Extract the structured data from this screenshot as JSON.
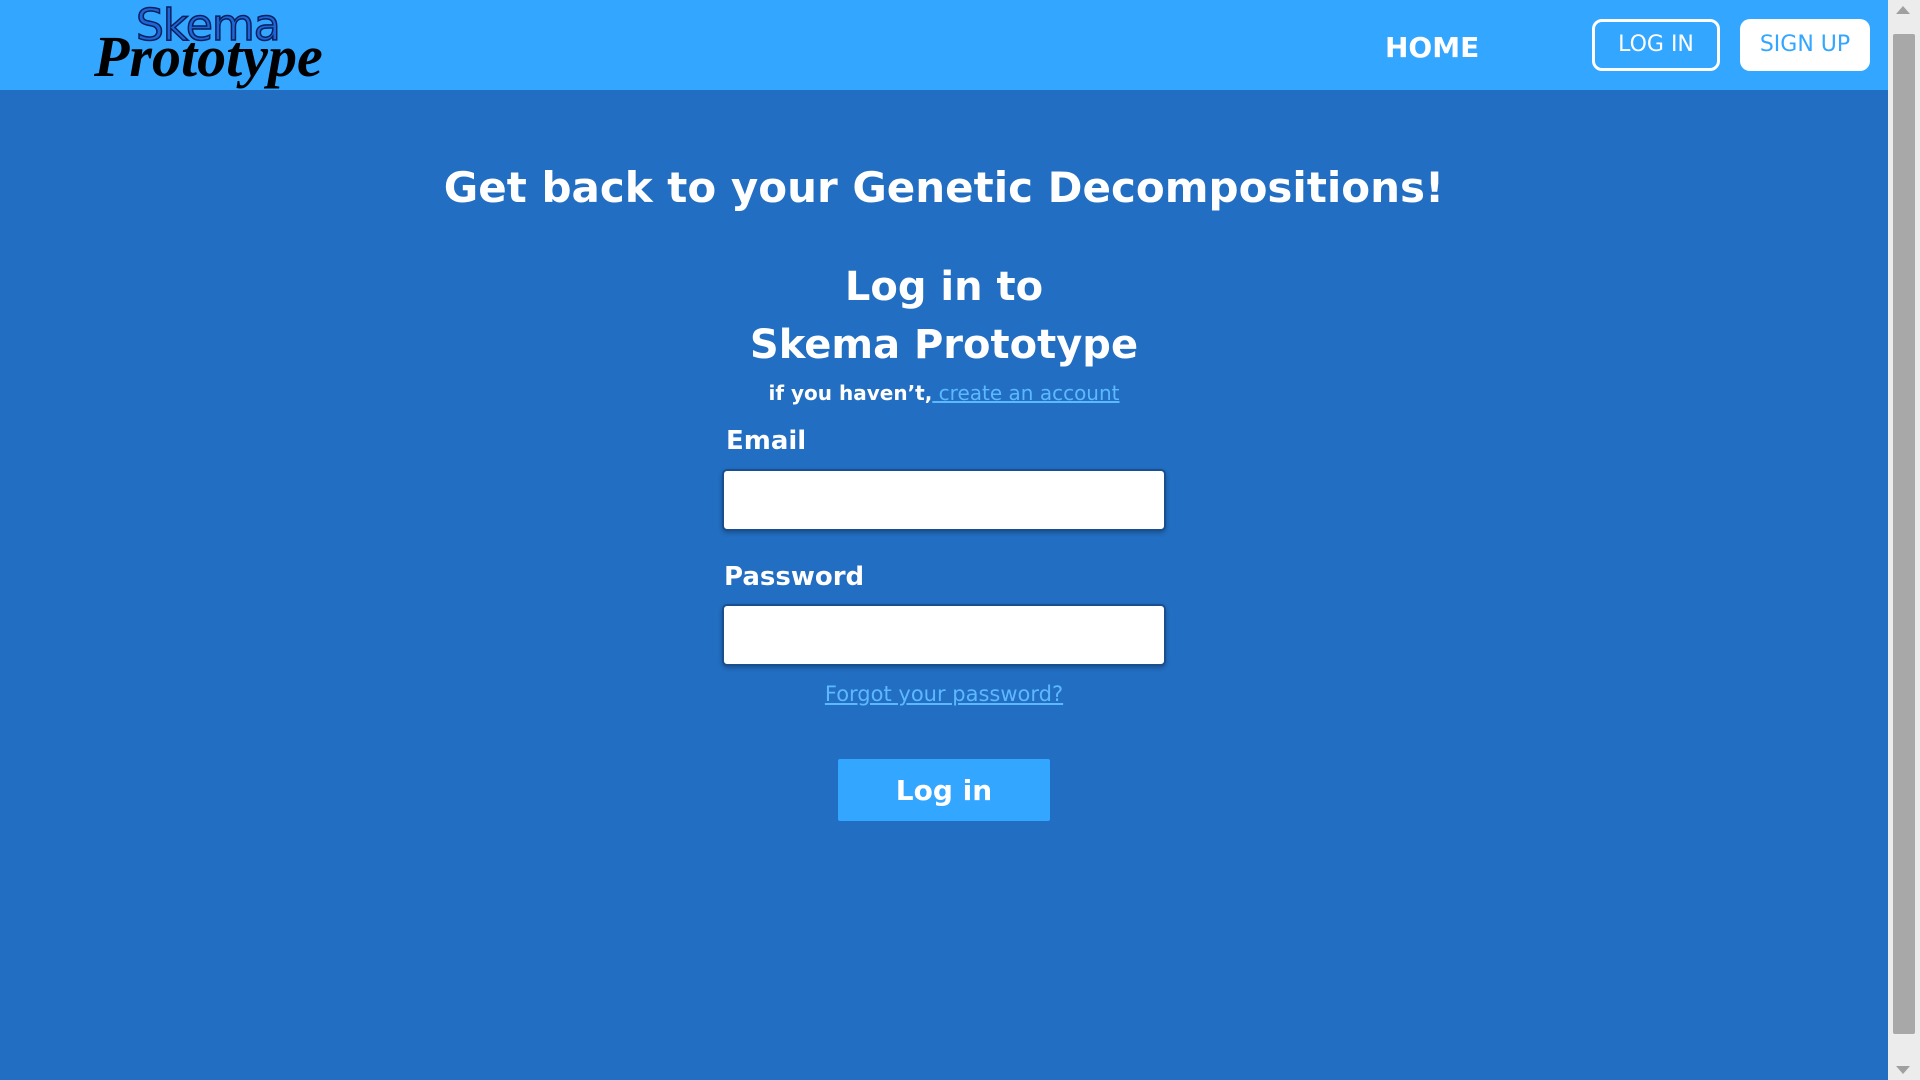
{
  "header": {
    "logo_top": "Skema",
    "logo_bottom": "Prototype",
    "nav_home": "HOME",
    "login_label": "LOG IN",
    "signup_label": "SIGN UP"
  },
  "main": {
    "headline": "Get back to your Genetic Decompositions!",
    "form_title_line1": "Log in to",
    "form_title_line2": "Skema Prototype",
    "signup_hint_prefix": "if you haven’t,",
    "signup_hint_link": " create an account",
    "email_label": "Email",
    "email_value": "",
    "password_label": "Password",
    "password_value": "",
    "forgot_link": "Forgot your password?",
    "submit_label": "Log in"
  },
  "colors": {
    "page_background": "#226ec2",
    "navbar_background": "#33a6ff",
    "link": "#5cb8ff",
    "text": "#ffffff"
  }
}
